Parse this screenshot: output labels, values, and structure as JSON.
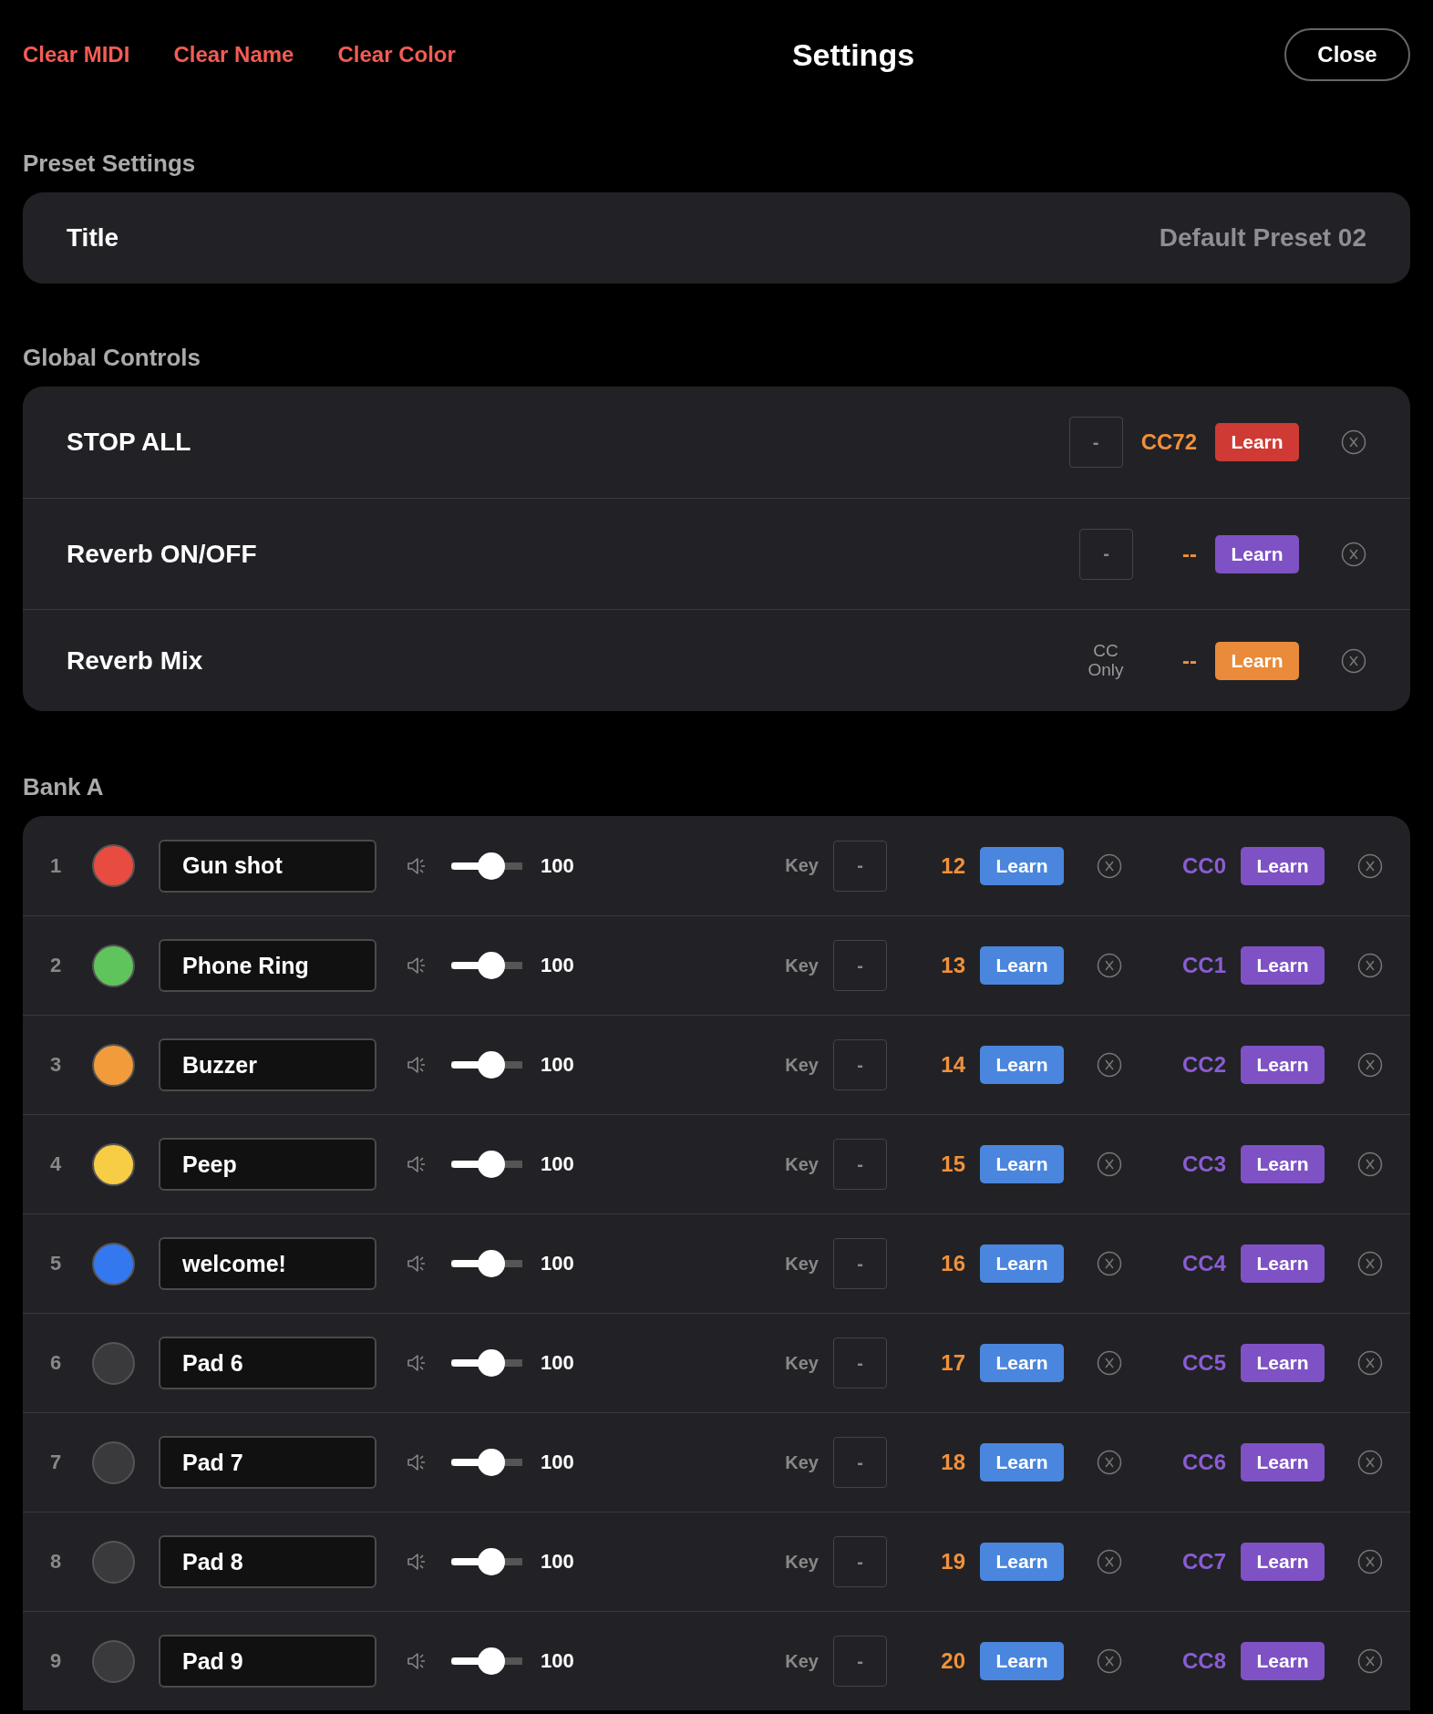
{
  "header": {
    "actions": [
      "Clear MIDI",
      "Clear Name",
      "Clear Color"
    ],
    "title": "Settings",
    "close": "Close"
  },
  "preset_settings": {
    "heading": "Preset Settings",
    "label": "Title",
    "value": "Default Preset 02"
  },
  "global_controls": {
    "heading": "Global Controls",
    "rows": [
      {
        "kind": "note",
        "label": "STOP ALL",
        "key": "-",
        "mapping": "CC72",
        "learn": "Learn",
        "color": "#cf3b34"
      },
      {
        "kind": "note",
        "label": "Reverb ON/OFF",
        "key": "-",
        "mapping": "--",
        "learn": "Learn",
        "color": "#7e52c4"
      },
      {
        "kind": "cc_only",
        "label": "Reverb Mix",
        "note": "CC Only",
        "mapping": "--",
        "learn": "Learn",
        "color": "#e98b3a"
      }
    ]
  },
  "bank": {
    "heading": "Bank A",
    "pads": [
      {
        "number": "1",
        "color": "#e84b3f",
        "name": "Gun shot",
        "level": 0.6,
        "volume": "100",
        "key_label": "Key",
        "key": "-",
        "note": "12",
        "note_learn": "Learn",
        "cc": "CC0",
        "cc_learn": "Learn"
      },
      {
        "number": "2",
        "color": "#5fc45b",
        "name": "Phone Ring",
        "level": 0.6,
        "volume": "100",
        "key_label": "Key",
        "key": "-",
        "note": "13",
        "note_learn": "Learn",
        "cc": "CC1",
        "cc_learn": "Learn"
      },
      {
        "number": "3",
        "color": "#f19b3b",
        "name": "Buzzer",
        "level": 0.6,
        "volume": "100",
        "key_label": "Key",
        "key": "-",
        "note": "14",
        "note_learn": "Learn",
        "cc": "CC2",
        "cc_learn": "Learn"
      },
      {
        "number": "4",
        "color": "#f7cd45",
        "name": "Peep",
        "level": 0.6,
        "volume": "100",
        "key_label": "Key",
        "key": "-",
        "note": "15",
        "note_learn": "Learn",
        "cc": "CC3",
        "cc_learn": "Learn"
      },
      {
        "number": "5",
        "color": "#3478f0",
        "name": "welcome!",
        "level": 0.6,
        "volume": "100",
        "key_label": "Key",
        "key": "-",
        "note": "16",
        "note_learn": "Learn",
        "cc": "CC4",
        "cc_learn": "Learn"
      },
      {
        "number": "6",
        "color": "#3a3a3d",
        "name": "Pad 6",
        "level": 0.6,
        "volume": "100",
        "key_label": "Key",
        "key": "-",
        "note": "17",
        "note_learn": "Learn",
        "cc": "CC5",
        "cc_learn": "Learn"
      },
      {
        "number": "7",
        "color": "#3a3a3d",
        "name": "Pad 7",
        "level": 0.6,
        "volume": "100",
        "key_label": "Key",
        "key": "-",
        "note": "18",
        "note_learn": "Learn",
        "cc": "CC6",
        "cc_learn": "Learn"
      },
      {
        "number": "8",
        "color": "#3a3a3d",
        "name": "Pad 8",
        "level": 0.6,
        "volume": "100",
        "key_label": "Key",
        "key": "-",
        "note": "19",
        "note_learn": "Learn",
        "cc": "CC7",
        "cc_learn": "Learn"
      },
      {
        "number": "9",
        "color": "#3a3a3d",
        "name": "Pad 9",
        "level": 0.6,
        "volume": "100",
        "key_label": "Key",
        "key": "-",
        "note": "20",
        "note_learn": "Learn",
        "cc": "CC8",
        "cc_learn": "Learn"
      }
    ]
  }
}
